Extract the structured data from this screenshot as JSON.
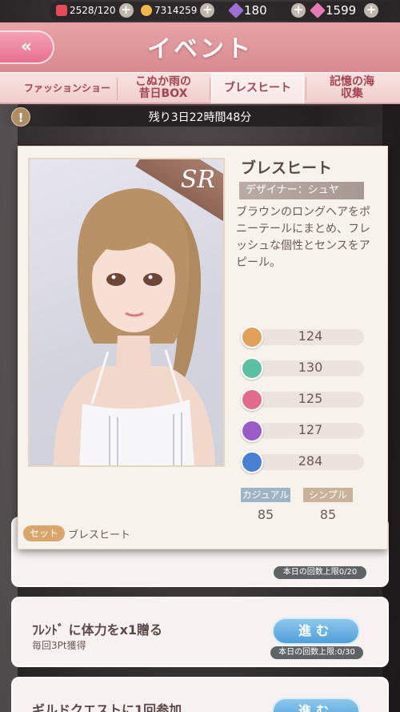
{
  "resources": {
    "stamina": "2528/120",
    "gold": "7314259",
    "diamond": "180",
    "star_jewel": "1599",
    "colors": {
      "stamina": "#e64a5a",
      "gold": "#f2b64a",
      "diamond": "#9b6fd6",
      "star_jewel": "#e57bb6"
    }
  },
  "header": {
    "back_label": "«",
    "title": "イベント"
  },
  "tabs": [
    {
      "label": "ファッションショー",
      "active": false
    },
    {
      "label": "こぬか雨の\n昔日BOX",
      "active": false
    },
    {
      "label": "ブレスヒート",
      "active": true
    },
    {
      "label": "記憶の海\n収集",
      "active": false
    }
  ],
  "countdown": {
    "text": "残り3日22時間48分",
    "alert_icon": "!"
  },
  "card": {
    "rarity": "SR",
    "name": "ブレスヒート",
    "designer": "デザイナー：シュヤ",
    "description": "ブラウンのロングヘアをポニーテールにまとめ、フレッシュな個性とセンスをアピール。",
    "stats": [
      {
        "icon": "elegant-icon",
        "value": "124",
        "color": "#e0a15a"
      },
      {
        "icon": "fresh-icon",
        "value": "130",
        "color": "#5cbfa1"
      },
      {
        "icon": "sweet-icon",
        "value": "125",
        "color": "#e26a8a"
      },
      {
        "icon": "sexy-icon",
        "value": "127",
        "color": "#9b5bc7"
      },
      {
        "icon": "cool-icon",
        "value": "284",
        "color": "#4b7fd1"
      }
    ],
    "styles": [
      {
        "label": "カジュアル",
        "value": "85",
        "color": "#9fb3c4"
      },
      {
        "label": "シンプル",
        "value": "85",
        "color": "#c9b19a"
      }
    ],
    "set_badge": "セット",
    "set_name": "ブレスヒート"
  },
  "tasks": [
    {
      "title": "",
      "sub": "",
      "button": "",
      "limit": "本日の回数上限0/20"
    },
    {
      "title": "ﾌﾚﾝﾄﾞ に体力をx1贈る",
      "sub": "毎回3Pt獲得",
      "button": "進む",
      "limit": "本日の回数上限:0/30"
    },
    {
      "title": "ギルドクエストに1回参加",
      "sub": "",
      "button": "進む",
      "limit": ""
    }
  ]
}
